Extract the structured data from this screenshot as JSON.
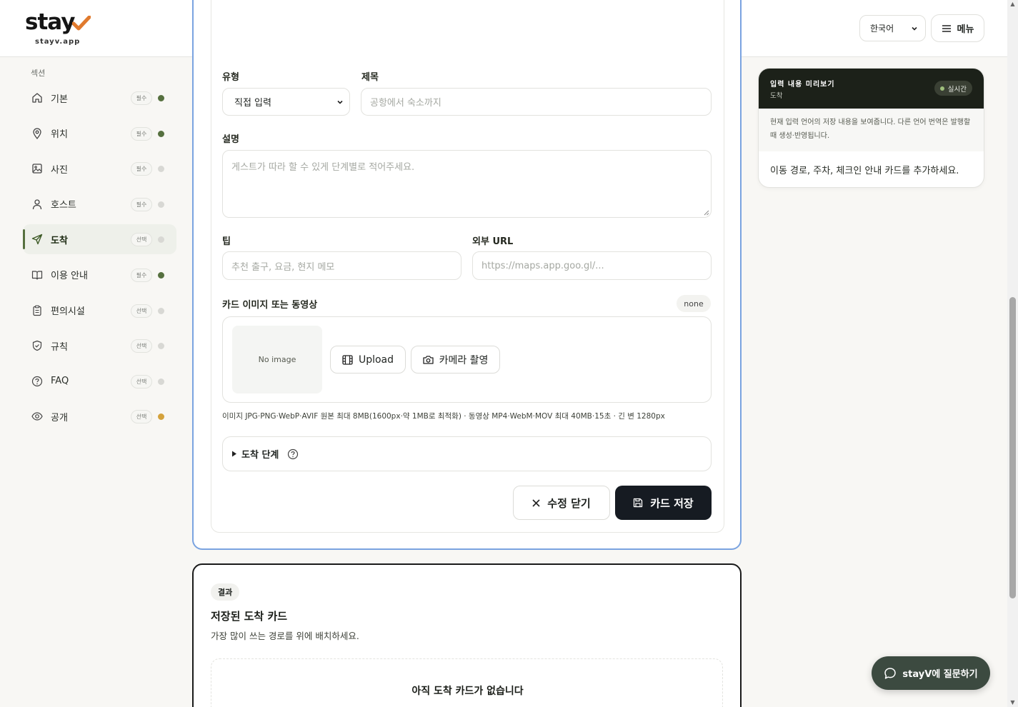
{
  "header": {
    "logo_word": "stay",
    "logo_sub": "stayv.app",
    "language": "한국어",
    "menu_label": "메뉴"
  },
  "sidebar": {
    "title": "섹션",
    "items": [
      {
        "label": "기본",
        "badge": "필수",
        "dot": "#56703f"
      },
      {
        "label": "위치",
        "badge": "필수",
        "dot": "#56703f"
      },
      {
        "label": "사진",
        "badge": "필수",
        "dot": "#d8d8d4"
      },
      {
        "label": "호스트",
        "badge": "필수",
        "dot": "#d8d8d4"
      },
      {
        "label": "도착",
        "badge": "선택",
        "dot": "#d8d8d4",
        "active": true
      },
      {
        "label": "이용 안내",
        "badge": "필수",
        "dot": "#56703f"
      },
      {
        "label": "편의시설",
        "badge": "선택",
        "dot": "#d8d8d4"
      },
      {
        "label": "규칙",
        "badge": "선택",
        "dot": "#d8d8d4"
      },
      {
        "label": "FAQ",
        "badge": "선택",
        "dot": "#d8d8d4"
      },
      {
        "label": "공개",
        "badge": "선택",
        "dot": "#d4a23c"
      }
    ]
  },
  "editor": {
    "type_label": "유형",
    "type_value": "직접 입력",
    "title_label": "제목",
    "title_placeholder": "공항에서 숙소까지",
    "desc_label": "설명",
    "desc_placeholder": "게스트가 따라 할 수 있게 단계별로 적어주세요.",
    "tip_label": "팁",
    "tip_placeholder": "추천 출구, 요금, 현지 메모",
    "url_label": "외부 URL",
    "url_placeholder": "https://maps.app.goo.gl/...",
    "media_label": "카드 이미지 또는 동영상",
    "media_status": "none",
    "no_image": "No image",
    "upload_label": "Upload",
    "camera_label": "카메라 촬영",
    "media_hint": "이미지 JPG·PNG·WebP·AVIF 원본 최대 8MB(1600px·약 1MB로 최적화) · 동영상 MP4·WebM·MOV 최대 40MB·15초 · 긴 변 1280px",
    "steps_label": "도착 단계",
    "close_label": "수정 닫기",
    "save_label": "카드 저장"
  },
  "results": {
    "tag": "결과",
    "title": "저장된 도착 카드",
    "subtitle": "가장 많이 쓰는 경로를 위에 배치하세요.",
    "empty": "아직 도착 카드가 없습니다"
  },
  "preview": {
    "title": "입력 내용 미리보기",
    "section": "도착",
    "live": "실시간",
    "note": "현재 입력 언어의 저장 내용을 보여줍니다. 다른 언어 번역은 발행할 때 생성·반영됩니다.",
    "body": "이동 경로, 주차, 체크인 안내 카드를 추가하세요."
  },
  "chat": {
    "label": "stayV에 질문하기"
  },
  "colors": {
    "accent_green": "#56703f",
    "logo_check": "#e07a2e",
    "editor_border": "#7aa3e0",
    "dark_button": "#161b22",
    "chat_button": "#3c4a40"
  }
}
